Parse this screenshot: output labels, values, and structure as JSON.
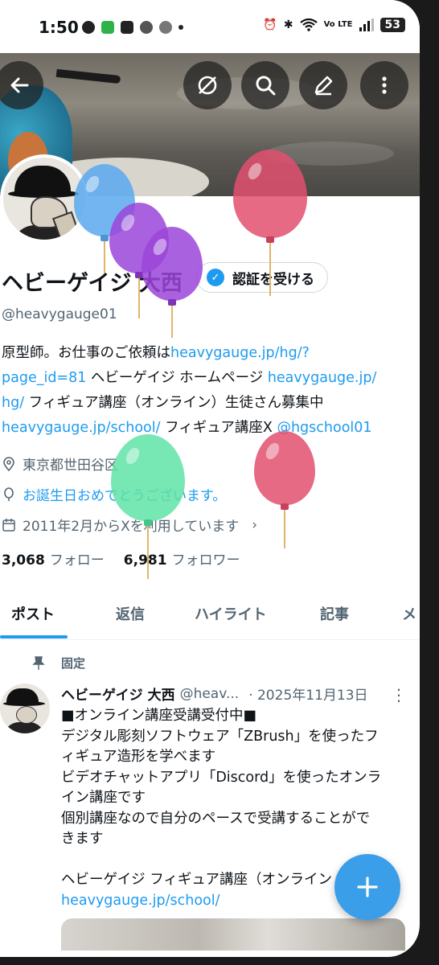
{
  "status_bar": {
    "time": "1:50",
    "network": "Vo LTE",
    "battery": "53"
  },
  "header_buttons": {
    "back": "back-arrow-icon",
    "grok": "grok-icon",
    "search": "search-icon",
    "edit": "edit-icon",
    "more": "more-vertical-icon"
  },
  "profile": {
    "name": "ヘビーゲイジ 大西",
    "verify_label": "認証を受ける",
    "handle": "@heavygauge01",
    "bio": {
      "l1_text": "原型師。お仕事のご依頼は",
      "l1_link": "heavygauge.jp/hg/?",
      "l2_link": "page_id=81",
      "l2_text_a": " ヘビーゲイジ ホームページ ",
      "l2_link_b": "heavygauge.jp/",
      "l3_link": "hg/",
      "l3_text": " フィギュア講座（オンライン）生徒さん募集中",
      "l4_link": "heavygauge.jp/school/",
      "l4_text": " フィギュア講座X ",
      "l4_link_b": "@hgschool01"
    },
    "location": "東京都世田谷区",
    "birthday": "お誕生日おめでとうございます。",
    "joined": "2011年2月からXを利用しています",
    "following_count": "3,068",
    "following_label": "フォロー",
    "followers_count": "6,981",
    "followers_label": "フォロワー"
  },
  "tabs": [
    "ポスト",
    "返信",
    "ハイライト",
    "記事",
    "メ"
  ],
  "pinned": {
    "label": "固定",
    "author": "ヘビーゲイジ 大西",
    "handle": "@heav...",
    "date": "· 2025年11月13日",
    "lines": [
      "■オンライン講座受講受付中■",
      "デジタル彫刻ソフトウェア「ZBrush」を使ったフ",
      "ィギュア造形を学べます",
      "ビデオチャットアプリ「Discord」を使ったオンラ",
      "イン講座です",
      "個別講座なので自分のペースで受講することがで",
      "きます",
      "",
      "ヘビーゲイジ フィギュア講座（オンライン"
    ],
    "link": "heavygauge.jp/school/"
  },
  "fab": {
    "icon": "plus-icon"
  },
  "colors": {
    "accent": "#1d9bf0",
    "text": "#0f1419",
    "muted": "#536471",
    "balloon_blue": "#5aa8ef",
    "balloon_purple": "#9b45d9",
    "balloon_red": "#e2506e",
    "balloon_green": "#5fe3a6"
  }
}
